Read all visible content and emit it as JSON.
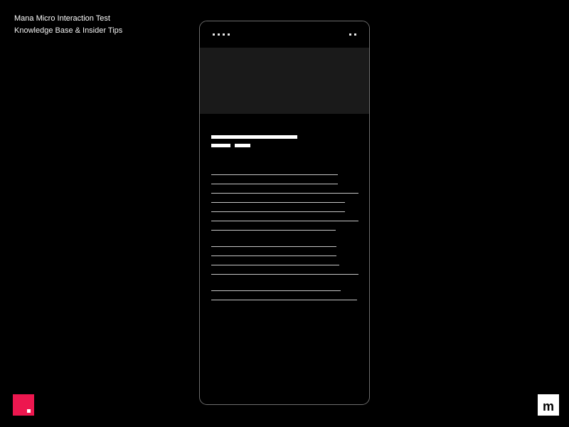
{
  "header": {
    "line1": "Mana Micro Interaction Test",
    "line2": "Knowledge Base & Insider Tips"
  },
  "logo_right_letter": "m"
}
